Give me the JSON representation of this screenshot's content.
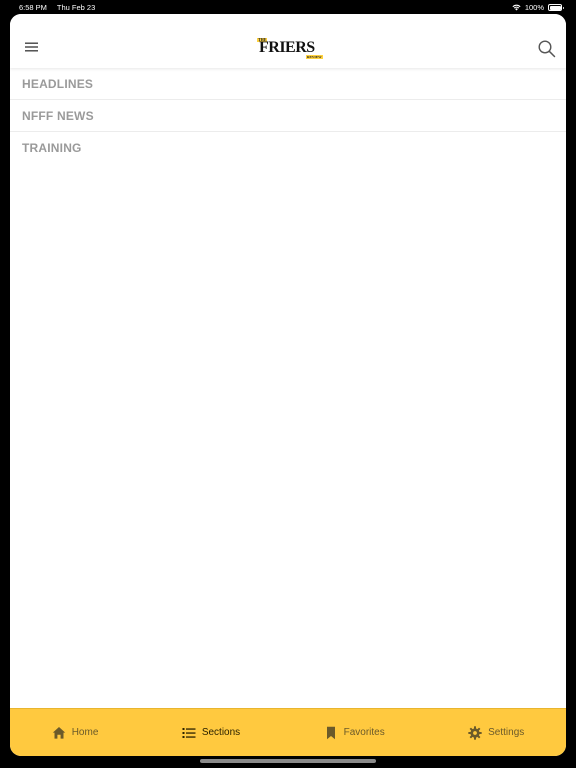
{
  "status_bar": {
    "time": "6:58 PM",
    "date": "Thu Feb 23",
    "battery": "100%"
  },
  "header": {
    "logo": {
      "top": "THE",
      "main": "FRIERS",
      "bottom": "REVIEW"
    },
    "menu_icon": "hamburger-icon",
    "search_icon": "search-icon"
  },
  "sections": [
    {
      "label": "HEADLINES"
    },
    {
      "label": "NFFF NEWS"
    },
    {
      "label": "TRAINING"
    }
  ],
  "tab_bar": {
    "items": [
      {
        "label": "Home",
        "icon": "home-icon",
        "active": false
      },
      {
        "label": "Sections",
        "icon": "list-icon",
        "active": true
      },
      {
        "label": "Favorites",
        "icon": "bookmark-icon",
        "active": false
      },
      {
        "label": "Settings",
        "icon": "gear-icon",
        "active": false
      }
    ]
  },
  "colors": {
    "tab_bar_background": "#ffc93f",
    "section_label": "#9a9a9a",
    "active_tab": "#2b2200",
    "inactive_tab": "#6b5a2a"
  }
}
